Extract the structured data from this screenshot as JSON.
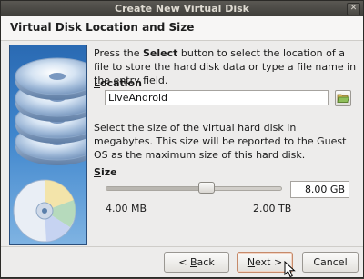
{
  "window": {
    "title": "Create New Virtual Disk",
    "close_glyph": "✕"
  },
  "header": {
    "title": "Virtual Disk Location and Size"
  },
  "location": {
    "intro_prefix": "Press the ",
    "intro_bold": "Select",
    "intro_suffix": " button to select the location of a file to store the hard disk data or type a file name in the entry field.",
    "label_mnemonic": "L",
    "label_rest": "ocation",
    "value": "LiveAndroid",
    "select_icon": "folder-open-icon"
  },
  "size": {
    "description": "Select the size of the virtual hard disk in megabytes. This size will be reported to the Guest OS as the maximum size of this hard disk.",
    "label_mnemonic": "S",
    "label_rest": "ize",
    "value": "8.00 GB",
    "slider_fraction": 0.57,
    "min_label": "4.00 MB",
    "max_label": "2.00 TB"
  },
  "buttons": {
    "back_arrow": "< ",
    "back_mnemonic": "B",
    "back_rest": "ack",
    "next_mnemonic": "N",
    "next_rest": "ext >",
    "cancel": "Cancel"
  },
  "colors": {
    "accent": "#2a6ab3",
    "titlebar": "#3f3e3a",
    "background": "#edeceb"
  }
}
